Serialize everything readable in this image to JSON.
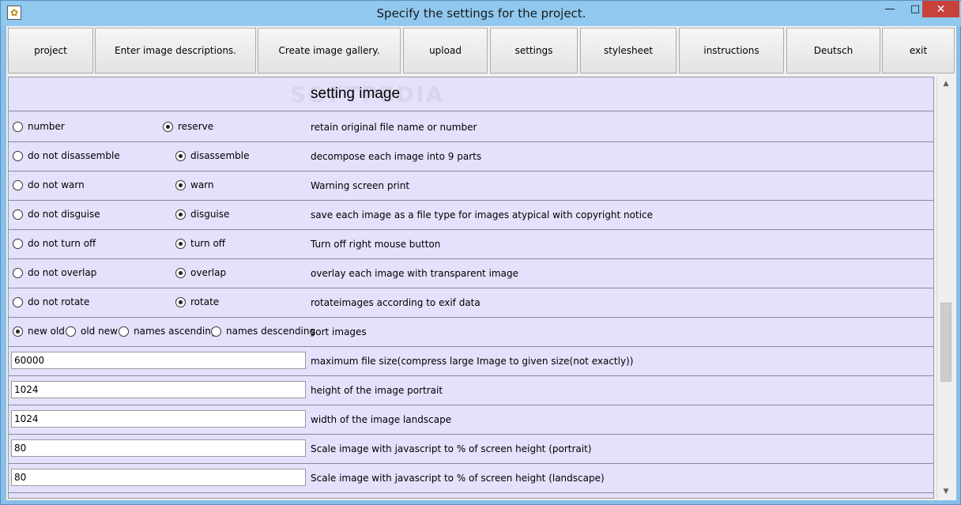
{
  "window": {
    "title": "Specify the settings for the project.",
    "minimize": "—",
    "maximize": "□",
    "close": "✕",
    "icon": "daisy-icon"
  },
  "toolbar": {
    "buttons": [
      {
        "label": "project"
      },
      {
        "label": "Enter image descriptions."
      },
      {
        "label": "Create image gallery."
      },
      {
        "label": "upload"
      },
      {
        "label": "settings"
      },
      {
        "label": "stylesheet"
      },
      {
        "label": "instructions"
      },
      {
        "label": "Deutsch"
      },
      {
        "label": "exit"
      }
    ]
  },
  "content": {
    "watermark": "SOFTPEDIA",
    "heading": "setting image",
    "radio_rows": [
      {
        "opt1": "number",
        "opt1_on": false,
        "opt2": "reserve",
        "opt2_on": true,
        "desc": "retain original file name or number"
      },
      {
        "opt1": "do not disassemble",
        "opt1_on": false,
        "opt2": "disassemble",
        "opt2_on": true,
        "desc": "decompose each image into 9 parts"
      },
      {
        "opt1": "do not warn",
        "opt1_on": false,
        "opt2": "warn",
        "opt2_on": true,
        "desc": "Warning screen print"
      },
      {
        "opt1": "do not disguise",
        "opt1_on": false,
        "opt2": "disguise",
        "opt2_on": true,
        "desc": "save each image as a file type for images atypical with copyright notice"
      },
      {
        "opt1": "do not turn off",
        "opt1_on": false,
        "opt2": "turn off",
        "opt2_on": true,
        "desc": "Turn off right mouse button"
      },
      {
        "opt1": "do not overlap",
        "opt1_on": false,
        "opt2": "overlap",
        "opt2_on": true,
        "desc": "overlay each image with transparent image"
      },
      {
        "opt1": "do not rotate",
        "opt1_on": false,
        "opt2": "rotate",
        "opt2_on": true,
        "desc": "rotateimages according to exif data"
      }
    ],
    "sort": {
      "options": [
        {
          "label": "new old",
          "on": true
        },
        {
          "label": "old new",
          "on": false
        },
        {
          "label": "names ascending",
          "on": false
        },
        {
          "label": "names descending",
          "on": false
        }
      ],
      "desc": "sort images"
    },
    "fields": [
      {
        "value": "60000",
        "desc": "maximum file size(compress large Image to given size(not exactly))"
      },
      {
        "value": "1024",
        "desc": "height of the image portrait"
      },
      {
        "value": "1024",
        "desc": "width of the image landscape"
      },
      {
        "value": "80",
        "desc": "Scale image with javascript to % of screen height (portrait)"
      },
      {
        "value": "80",
        "desc": "Scale image with javascript to % of screen height (landscape)"
      }
    ]
  },
  "scrollbar": {
    "up": "▲",
    "down": "▼"
  }
}
